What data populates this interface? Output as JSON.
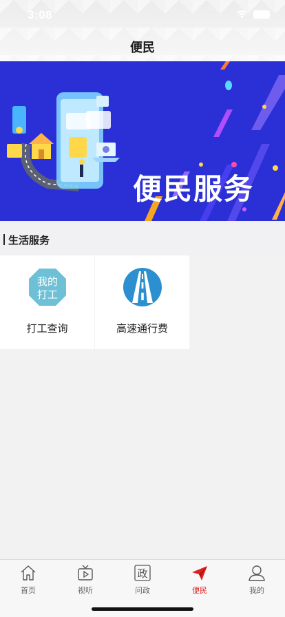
{
  "status_bar": {
    "time": "3:08"
  },
  "header": {
    "title": "便民"
  },
  "banner": {
    "title": "便民服务"
  },
  "section": {
    "title": "生活服务"
  },
  "services": [
    {
      "label": "打工查询",
      "icon": "my-work-icon",
      "icon_text_line1": "我的",
      "icon_text_line2": "打工"
    },
    {
      "label": "高速通行费",
      "icon": "highway-icon"
    }
  ],
  "tabbar": {
    "active_color": "#e02020",
    "items": [
      {
        "label": "首页",
        "icon": "home-icon"
      },
      {
        "label": "视听",
        "icon": "tv-icon"
      },
      {
        "label": "问政",
        "icon": "politics-icon",
        "icon_text": "政"
      },
      {
        "label": "便民",
        "icon": "paper-plane-icon",
        "active": true
      },
      {
        "label": "我的",
        "icon": "user-icon"
      }
    ]
  }
}
